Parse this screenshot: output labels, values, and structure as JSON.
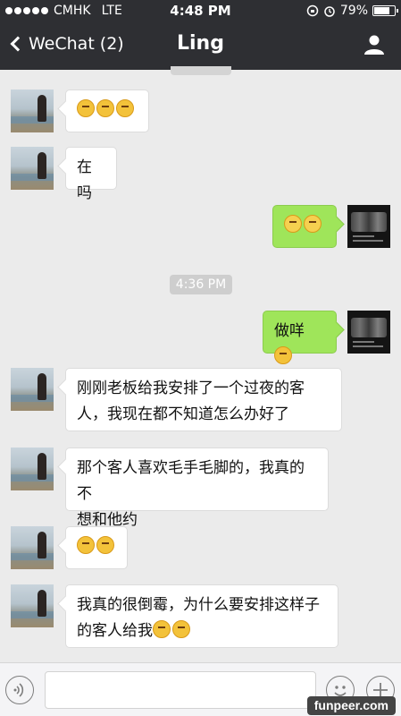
{
  "status_bar": {
    "carrier": "CMHK",
    "network": "LTE",
    "time": "4:48 PM",
    "battery": "79%",
    "battery_level": 0.79
  },
  "nav": {
    "back_label": "WeChat (2)",
    "title": "Ling"
  },
  "chat": {
    "timestamp": "4:36 PM",
    "messages": [
      {
        "side": "left",
        "text": ""
      },
      {
        "side": "left",
        "text": "在吗"
      },
      {
        "side": "right",
        "text": ""
      },
      {
        "side": "right",
        "text": "做咩"
      },
      {
        "side": "left",
        "line1": "刚刚老板给我安排了一个过夜的客",
        "line2": "人，我现在都不知道怎么办好了"
      },
      {
        "side": "left",
        "line1": "那个客人喜欢毛手毛脚的，我真的不",
        "line2": "想和他约"
      },
      {
        "side": "left",
        "text": ""
      },
      {
        "side": "left",
        "line1": "我真的很倒霉，为什么要安排这样子",
        "line2": "的客人给我"
      }
    ]
  },
  "watermark": "funpeer.com",
  "colors": {
    "header_bg": "#2e2f33",
    "chat_bg": "#ebebeb",
    "sent_bubble": "#9fe55a",
    "received_bubble": "#ffffff"
  },
  "icons": [
    "back-chevron-icon",
    "profile-icon",
    "voice-icon",
    "emoji-icon",
    "plus-icon"
  ]
}
